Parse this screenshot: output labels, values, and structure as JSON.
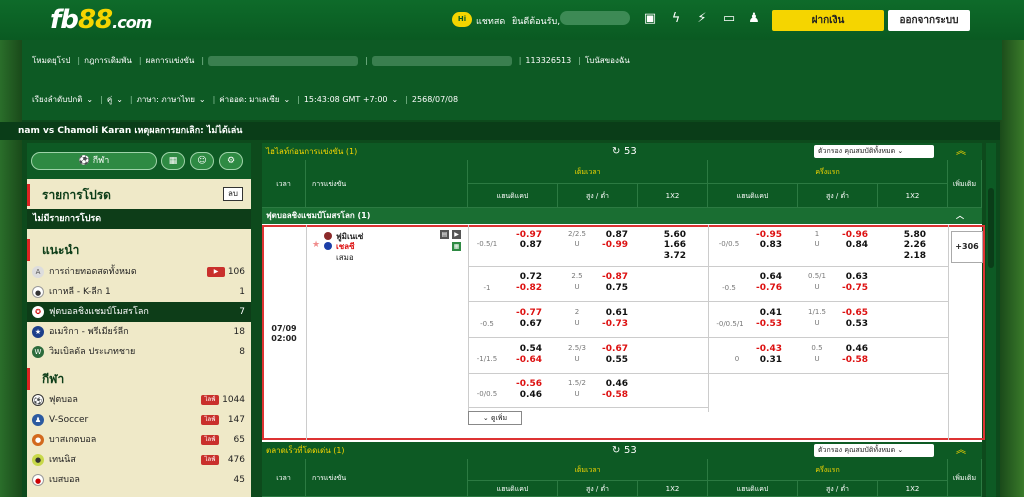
{
  "topbar": {
    "logo_main": "fb",
    "logo_num": "88",
    "logo_tld": ".com",
    "chat_badge": "Hi",
    "chat_label": "แชทสด",
    "welcome": "ยินดีต้อนรับ,",
    "deposit_label": "ฝากเงิน",
    "logout_label": "ออกจากระบบ"
  },
  "nav": {
    "row1": [
      "โหมดยุโรป",
      "กฎการเดิมพัน",
      "ผลการแข่งขัน",
      "113326513",
      "โบนัสของฉัน"
    ],
    "row2": [
      "เรียงลำดับปกติ",
      "คู่",
      "ภาษา: ภาษาไทย",
      "ค่าออด: มาเลเซีย",
      "15:43:08 GMT +7:00",
      "2568/07/08"
    ]
  },
  "ticker": "nam vs Chamoli Karan เหตุผลการยกเลิก: ไม่ได้เล่น",
  "sidebar": {
    "sports_btn": "กีฬา",
    "bet_list_title": "รายการโปรด",
    "lob_btn": "ลบ",
    "no_list": "ไม่มีรายการโปรด",
    "rec_title": "แนะนำ",
    "rec_items": [
      {
        "label": "การถ่ายทอดสดทั้งหมด",
        "count": "106",
        "live": true
      },
      {
        "label": "เกาหลี - K-ลีก 1",
        "count": "1",
        "live": false
      },
      {
        "label": "ฟุตบอลชิงแชมป์โมสรโลก",
        "count": "7",
        "live": false,
        "selected": true
      },
      {
        "label": "อเมริกา - พรีเมียร์ลีก",
        "count": "18",
        "live": false
      },
      {
        "label": "วิมเบิลดัล ประเภทชาย",
        "count": "8",
        "live": false
      }
    ],
    "sport_title": "กีฬา",
    "sports": [
      {
        "label": "ฟุตบอล",
        "count": "1044",
        "live": "ไลฟ์"
      },
      {
        "label": "V-Soccer",
        "count": "147",
        "live": "ไลฟ์"
      },
      {
        "label": "บาสเกตบอล",
        "count": "65",
        "live": "ไลฟ์"
      },
      {
        "label": "เทนนิส",
        "count": "476",
        "live": "ไลฟ์"
      },
      {
        "label": "เบสบอล",
        "count": "45",
        "live": ""
      }
    ]
  },
  "main": {
    "section1_title": "ไฮไลท์ก่อนการแข่งขัน (1)",
    "section1_count": "53",
    "filter_label": "ตัวกรอง คุณสมบัติทั้งหมด",
    "col_time": "เวลา",
    "col_match": "การแข่งขัน",
    "col_fulltime": "เต็มเวลา",
    "col_firsthalf": "ครึ่งแรก",
    "col_hdp": "แฮนดิแคป",
    "col_ou": "สูง / ต่ำ",
    "col_1x2": "1X2",
    "col_more": "เพิ่มเติม",
    "league": "ฟุตบอลชิงแชมป์โมสรโลก (1)",
    "match_date": "07/09",
    "match_time": "02:00",
    "home": "ฟูมิเนเซ่",
    "away": "เชลซี",
    "draw": "เสมอ",
    "plus_more": "+306",
    "more_btn": "ดูเพิ่ม",
    "rows": [
      {
        "ft_hdp": "-0.5/1",
        "ft_h1": "-0.97",
        "ft_h2": "0.87",
        "ft_ou": "2/2.5",
        "ft_ou_u": "U",
        "ft_o1": "0.87",
        "ft_o2": "-0.99",
        "x1": "5.60",
        "x2": "1.66",
        "x3": "3.72",
        "fh_hdp": "-0/0.5",
        "fh_h1": "-0.95",
        "fh_h2": "0.83",
        "fh_ou": "1",
        "fh_ou_u": "U",
        "fh_o1": "-0.96",
        "fh_o2": "0.84",
        "y1": "5.80",
        "y2": "2.26",
        "y3": "2.18"
      },
      {
        "ft_hdp": "-1",
        "ft_h1": "0.72",
        "ft_h2": "-0.82",
        "ft_ou": "2.5",
        "ft_ou_u": "U",
        "ft_o1": "-0.87",
        "ft_o2": "0.75",
        "fh_hdp": "-0.5",
        "fh_h1": "0.64",
        "fh_h2": "-0.76",
        "fh_ou": "0.5/1",
        "fh_ou_u": "U",
        "fh_o1": "0.63",
        "fh_o2": "-0.75"
      },
      {
        "ft_hdp": "-0.5",
        "ft_h1": "-0.77",
        "ft_h2": "0.67",
        "ft_ou": "2",
        "ft_ou_u": "U",
        "ft_o1": "0.61",
        "ft_o2": "-0.73",
        "fh_hdp": "-0/0.5/1",
        "fh_h1": "0.41",
        "fh_h2": "-0.53",
        "fh_ou": "1/1.5",
        "fh_ou_u": "U",
        "fh_o1": "-0.65",
        "fh_o2": "0.53"
      },
      {
        "ft_hdp": "-1/1.5",
        "ft_h1": "0.54",
        "ft_h2": "-0.64",
        "ft_ou": "2.5/3",
        "ft_ou_u": "U",
        "ft_o1": "-0.67",
        "ft_o2": "0.55",
        "fh_hdp": "0",
        "fh_h1": "-0.43",
        "fh_h2": "0.31",
        "fh_ou": "0.5",
        "fh_ou_u": "U",
        "fh_o1": "0.46",
        "fh_o2": "-0.58"
      },
      {
        "ft_hdp": "-0/0.5",
        "ft_h1": "-0.56",
        "ft_h2": "0.46",
        "ft_ou": "1.5/2",
        "ft_ou_u": "U",
        "ft_o1": "0.46",
        "ft_o2": "-0.58"
      }
    ],
    "section2_title": "ตลาดเร็วที่โดดเด่น (1)",
    "section2_count": "53"
  }
}
